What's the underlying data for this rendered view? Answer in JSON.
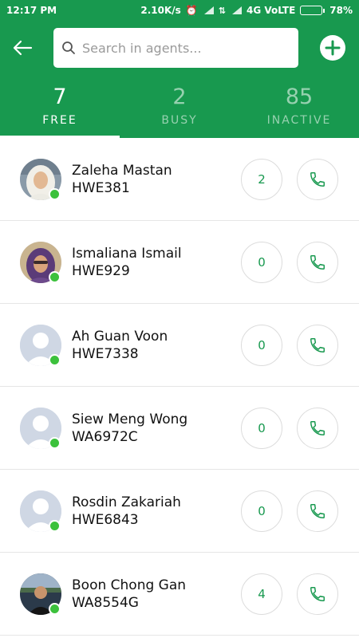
{
  "status_bar": {
    "time": "12:17 PM",
    "network_speed": "2.10K/s",
    "network_type": "4G VoLTE",
    "battery_percent": "78%",
    "battery_level": 0.78
  },
  "toolbar": {
    "back_icon": "arrow-left-icon",
    "search_placeholder": "Search in agents...",
    "search_value": "",
    "add_icon": "plus-icon"
  },
  "tabs": [
    {
      "count": "7",
      "label": "FREE",
      "active": true
    },
    {
      "count": "2",
      "label": "BUSY",
      "active": false
    },
    {
      "count": "85",
      "label": "INACTIVE",
      "active": false
    }
  ],
  "agents": [
    {
      "name": "Zaleha Mastan",
      "code": "HWE381",
      "count": "2",
      "avatar": "photo-woman-hijab-white",
      "online": true
    },
    {
      "name": "Ismaliana Ismail",
      "code": "HWE929",
      "count": "0",
      "avatar": "photo-woman-hijab-purple",
      "online": true
    },
    {
      "name": "Ah Guan Voon",
      "code": "HWE7338",
      "count": "0",
      "avatar": "default-avatar",
      "online": true
    },
    {
      "name": "Siew Meng Wong",
      "code": "WA6972C",
      "count": "0",
      "avatar": "default-avatar",
      "online": true
    },
    {
      "name": "Rosdin Zakariah",
      "code": "HWE6843",
      "count": "0",
      "avatar": "default-avatar",
      "online": true
    },
    {
      "name": "Boon Chong Gan",
      "code": "WA8554G",
      "count": "4",
      "avatar": "photo-man-outdoor",
      "online": true
    }
  ],
  "colors": {
    "brand_green": "#18994f",
    "online_green": "#3cc13c",
    "avatar_placeholder": "#cfd7e4"
  }
}
